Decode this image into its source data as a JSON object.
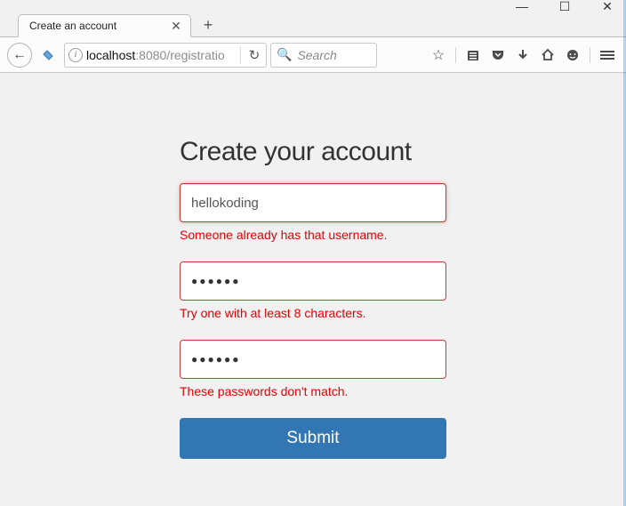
{
  "window": {
    "controls": {
      "min": "—",
      "max": "☐",
      "close": "✕"
    }
  },
  "tab": {
    "title": "Create an account",
    "close_glyph": "✕",
    "newtab_glyph": "+"
  },
  "toolbar": {
    "back_glyph": "←",
    "info_glyph": "i",
    "url_host": "localhost",
    "url_path": ":8080/registratio",
    "reload_glyph": "↻",
    "search_placeholder": "Search",
    "search_icon": "🔍",
    "icons": {
      "star": "☆",
      "library": "▭",
      "pocket": "⌄",
      "download": "↓",
      "home": "⌂",
      "chat": "☻",
      "menu": "≡"
    }
  },
  "form": {
    "heading": "Create your account",
    "username_value": "hellokoding",
    "username_error": "Someone already has that username.",
    "password_mask": "●●●●●●",
    "password_error": "Try one with at least 8 characters.",
    "confirm_mask": "●●●●●●",
    "confirm_error": "These passwords don't match.",
    "submit_label": "Submit"
  }
}
